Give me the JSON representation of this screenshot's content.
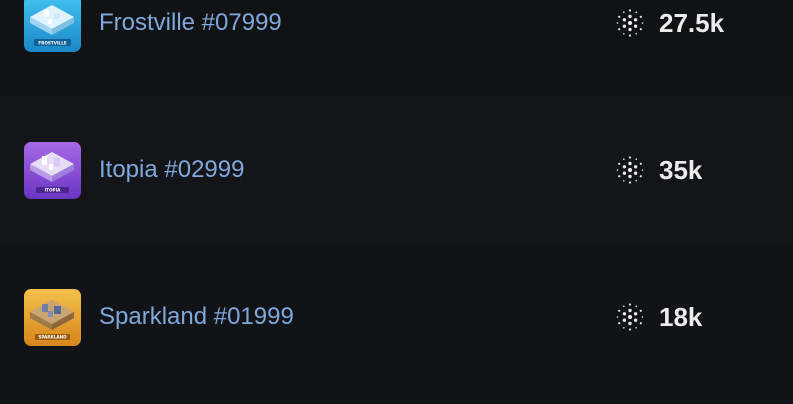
{
  "listings": [
    {
      "name": "Frostville #07999",
      "thumbnail_icon": "frostville-land-icon",
      "thumbnail_label": "FROSTVILLE",
      "thumbnail_color": "#2aa7d8",
      "currency_icon": "cardano-icon",
      "price": "27.5k"
    },
    {
      "name": "Itopia #02999",
      "thumbnail_icon": "itopia-land-icon",
      "thumbnail_label": "ITOPIA",
      "thumbnail_color": "#8a4fd6",
      "currency_icon": "cardano-icon",
      "price": "35k"
    },
    {
      "name": "Sparkland #01999",
      "thumbnail_icon": "sparkland-land-icon",
      "thumbnail_label": "SPARKLAND",
      "thumbnail_color": "#e5a12a",
      "currency_icon": "cardano-icon",
      "price": "18k"
    }
  ],
  "colors": {
    "background": "#121316",
    "name_text": "#7fa8dd",
    "price_text": "#ececec"
  }
}
